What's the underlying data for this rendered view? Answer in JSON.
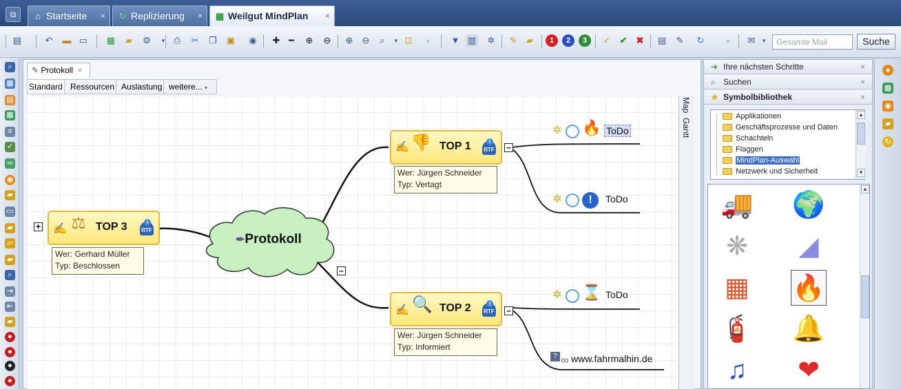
{
  "tabs": [
    {
      "label": "Startseite",
      "icon": "home-icon"
    },
    {
      "label": "Replizierung",
      "icon": "replication-icon"
    },
    {
      "label": "Weilgut MindPlan",
      "icon": "mindplan-icon",
      "active": true
    }
  ],
  "toolbar": {
    "search_placeholder": "Gesamte Mail",
    "search_button": "Suche"
  },
  "document": {
    "tab_label": "Protokoll",
    "view_tabs": [
      "Standard",
      "Ressourcen",
      "Auslastung",
      "weitere..."
    ],
    "side_tabs": [
      "Map",
      "Gantt"
    ]
  },
  "mindmap": {
    "center": "Protokoll",
    "nodes": [
      {
        "title": "TOP 1",
        "who": "Wer: Jürgen Schneider",
        "type": "Typ: Vertagt"
      },
      {
        "title": "TOP 2",
        "who": "Wer: Jürgen Schneider",
        "type": "Typ: Informiert"
      },
      {
        "title": "TOP 3",
        "who": "Wer: Gerhard Müller",
        "type": "Typ: Beschlossen"
      }
    ],
    "rtf_badge": "RTF",
    "todo_label": "ToDo",
    "link_label": "www.fahrmalhin.de",
    "expand_symbol": "+",
    "collapse_symbol": "–"
  },
  "right_panel": {
    "next_steps": "Ihre nächsten Schritte",
    "search": "Suchen",
    "symbol_library": "Symbolbibliothek",
    "tree_items": [
      "Applikationen",
      "Geschäftsprozesse und Daten",
      "Schachteln",
      "Flaggen",
      "MindPlan-Auswahl",
      "Netzwerk und Sicherheit"
    ],
    "selected_tree_item": "MindPlan-Auswahl"
  },
  "colors": {
    "node_fill": "#fde77a",
    "node_border": "#e2b93b",
    "cloud_fill": "#c8f0c0",
    "tab_bar": "#2a4a7d"
  }
}
